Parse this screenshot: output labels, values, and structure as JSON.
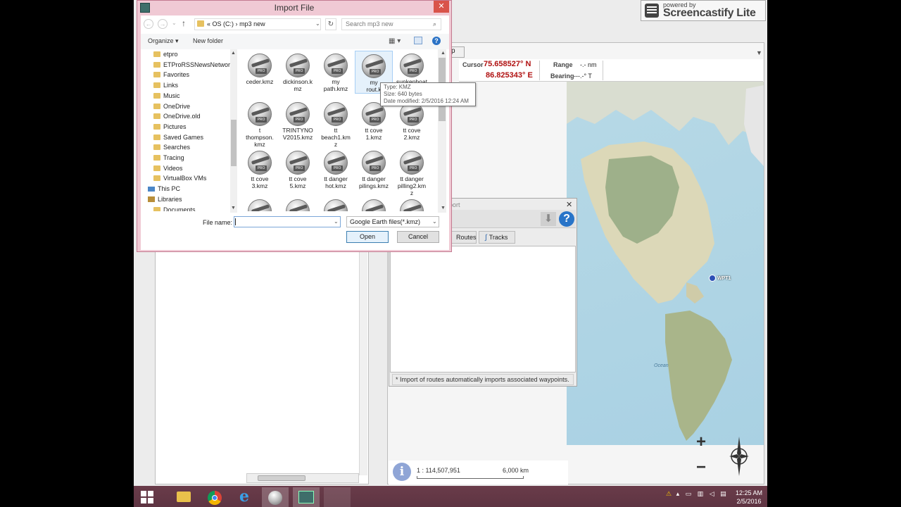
{
  "dialog": {
    "title": "Import File",
    "close": "✕",
    "nav": {
      "back": "←",
      "forward": "→",
      "up": "↑"
    },
    "address": {
      "prefix": "«",
      "parts": [
        "OS (C:)",
        "mp3 new"
      ],
      "separator": "›",
      "dropdown": "⌄"
    },
    "search_placeholder": "Search mp3 new",
    "organize": "Organize ▾",
    "new_folder": "New folder",
    "tree": [
      {
        "label": "etpro",
        "icon": "folder"
      },
      {
        "label": "ETProRSSNewsNetwork",
        "icon": "folder"
      },
      {
        "label": "Favorites",
        "icon": "folder"
      },
      {
        "label": "Links",
        "icon": "folder"
      },
      {
        "label": "Music",
        "icon": "folder"
      },
      {
        "label": "OneDrive",
        "icon": "folder"
      },
      {
        "label": "OneDrive.old",
        "icon": "folder"
      },
      {
        "label": "Pictures",
        "icon": "folder"
      },
      {
        "label": "Saved Games",
        "icon": "folder"
      },
      {
        "label": "Searches",
        "icon": "folder"
      },
      {
        "label": "Tracing",
        "icon": "folder"
      },
      {
        "label": "Videos",
        "icon": "folder"
      },
      {
        "label": "VirtualBox VMs",
        "icon": "folder"
      },
      {
        "label": "This PC",
        "icon": "pc"
      },
      {
        "label": "Libraries",
        "icon": "library"
      },
      {
        "label": "Documents",
        "icon": "folder"
      }
    ],
    "files": [
      "ceder.kmz",
      "dickinson.kmz",
      "my path.kmz",
      "my rout.kmz",
      "sunkenboat",
      "t thompson.kmz",
      "TRINTYNO V2015.kmz",
      "tt beach1.kmz",
      "tt cove 1.kmz",
      "tt cove 2.kmz",
      "tt cove 3.kmz",
      "tt cove 5.kmz",
      "tt danger hot.kmz",
      "tt danger pilings.kmz",
      "tt danger pilling2.kmz",
      "",
      "",
      "",
      "",
      ""
    ],
    "file_labels": [
      [
        "ceder.kmz"
      ],
      [
        "dickinson.k",
        "mz"
      ],
      [
        "my",
        "path.kmz"
      ],
      [
        "my",
        "rout.k"
      ],
      [
        "sunkenboat"
      ],
      [
        "t",
        "thompson.",
        "kmz"
      ],
      [
        "TRINTYNO",
        "V2015.kmz"
      ],
      [
        "tt",
        "beach1.km",
        "z"
      ],
      [
        "tt cove",
        "1.kmz"
      ],
      [
        "tt cove",
        "2.kmz"
      ],
      [
        "tt cove",
        "3.kmz"
      ],
      [
        "tt cove",
        "5.kmz"
      ],
      [
        "tt danger",
        "hot.kmz"
      ],
      [
        "tt danger",
        "pilings.kmz"
      ],
      [
        "tt danger",
        "pilling2.km",
        "z"
      ],
      [
        ""
      ],
      [
        ""
      ],
      [
        ""
      ],
      [
        ""
      ],
      [
        ""
      ]
    ],
    "tooltip": {
      "type": "Type: KMZ",
      "size": "Size: 640 bytes",
      "modified": "Date modified: 2/5/2016 12:24 AM"
    },
    "file_name_label": "File name:",
    "file_name_value": "",
    "file_type": "Google Earth files(*.kmz)",
    "open": "Open",
    "cancel": "Cancel"
  },
  "background": {
    "map_tab": "p",
    "cursor_label": "Cursor",
    "cursor_lat": "75.658527° N",
    "cursor_lon": "86.825343° E",
    "range_label": "Range",
    "range_value": "-.- nm",
    "bearing_label": "Bearing",
    "bearing_value": "---.-° T",
    "import_title": "port",
    "import_close": "✕",
    "tab_routes": "Routes",
    "tab_tracks": "Tracks",
    "import_note": "* Import of routes automatically imports associated waypoints.",
    "scale": "1 : 114,507,951",
    "scale_km": "6,000 km",
    "waypoint": "WPT1",
    "ocean_label": "Ocean",
    "zoom_in": "+",
    "zoom_out": "−"
  },
  "screencastify": {
    "powered": "powered by",
    "brand": "Screencastify Lite"
  },
  "taskbar": {
    "time": "12:25 AM",
    "date": "2/5/2016",
    "apps": [
      "file-explorer",
      "chrome",
      "internet-explorer",
      "google-earth",
      "app",
      "app-blank"
    ]
  },
  "colors": {
    "dialog_border": "#f0c9d4",
    "taskbar": "#6a3c4a",
    "cursor_value": "#b01010",
    "accent": "#2874c8"
  }
}
